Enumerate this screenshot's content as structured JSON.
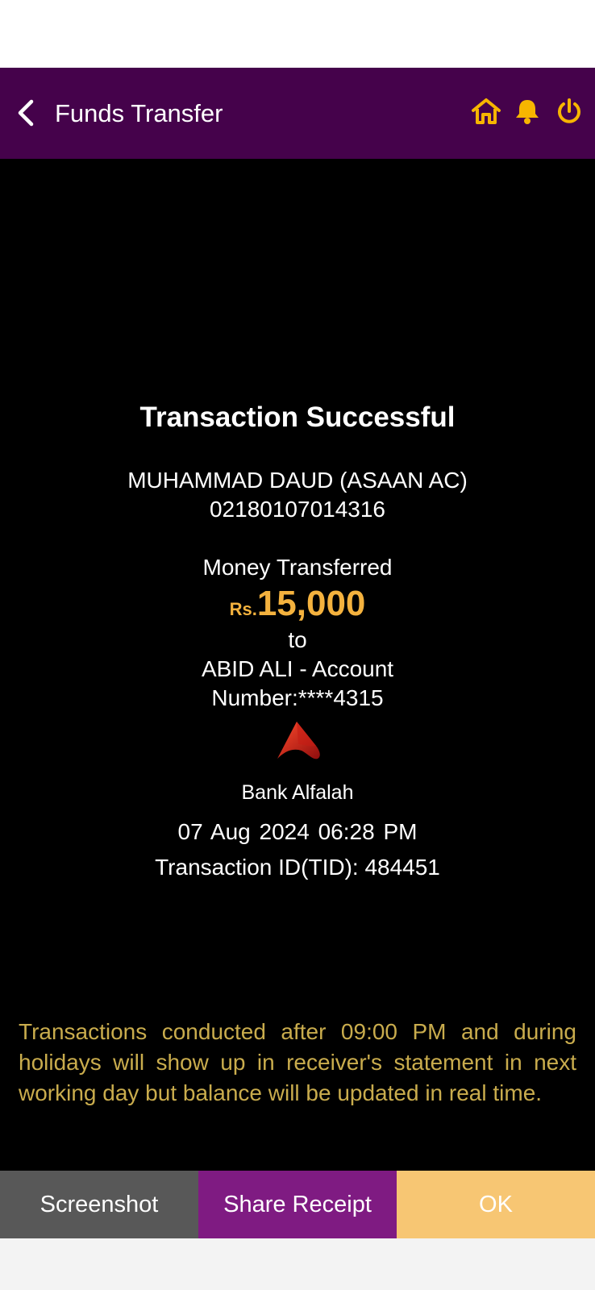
{
  "header": {
    "title": "Funds Transfer",
    "back_icon": "chevron-left-icon",
    "icons": [
      "home-icon",
      "bell-icon",
      "power-icon"
    ],
    "bg_color": "#45024b",
    "icon_color": "#f7b500"
  },
  "receipt": {
    "title": "Transaction Successful",
    "sender_name": "MUHAMMAD DAUD (ASAAN AC)",
    "sender_account": "02180107014316",
    "money_label": "Money Transferred",
    "currency": "Rs.",
    "amount": "15,000",
    "to_label": "to",
    "recipient_line1": "ABID ALI  - Account",
    "recipient_line2": "Number:****4315",
    "bank_icon": "bank-alfalah-logo-icon",
    "bank_name": "Bank Alfalah",
    "datetime": "07 Aug 2024  06:28 PM",
    "tid": "Transaction ID(TID): 484451",
    "amount_color": "#f4b23e"
  },
  "notice": {
    "text": "Transactions conducted after 09:00 PM and during holidays will show up in receiver's statement in next working day but balance will be updated in real time.",
    "color": "#c9ac4d"
  },
  "buttons": {
    "screenshot": "Screenshot",
    "share": "Share Receipt",
    "ok": "OK"
  }
}
